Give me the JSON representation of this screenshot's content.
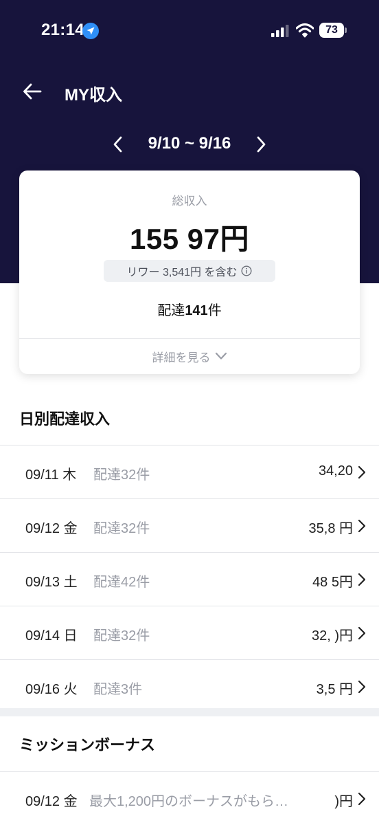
{
  "status_bar": {
    "time": "21:14",
    "battery": "73",
    "icons": [
      "location-arrow-icon",
      "signal-icon",
      "wifi-icon",
      "battery-icon"
    ]
  },
  "header": {
    "title": "MY収入",
    "date_range": "9/10 ~ 9/16",
    "background_color": "#17143c"
  },
  "summary_card": {
    "label": "総収入",
    "total": "155 97円",
    "reward_text": "リワー 3,541円 を含む",
    "delivery_count_prefix": "配達",
    "delivery_count": "141",
    "delivery_count_suffix": "件",
    "details_label": "詳細を見る"
  },
  "daily_section": {
    "title": "日別配達収入",
    "rows": [
      {
        "date": "09/11 木",
        "count": "配達32件",
        "amount": "34,20"
      },
      {
        "date": "09/12 金",
        "count": "配達32件",
        "amount": "35,8 円"
      },
      {
        "date": "09/13 土",
        "count": "配達42件",
        "amount": "48 5円"
      },
      {
        "date": "09/14 日",
        "count": "配達32件",
        "amount": "32, )円"
      },
      {
        "date": "09/16 火",
        "count": "配達3件",
        "amount": "3,5 円"
      }
    ]
  },
  "bonus_section": {
    "title": "ミッションボーナス",
    "rows": [
      {
        "date": "09/12 金",
        "text": "最大1,200円のボーナスがもら…",
        "amount": ")円"
      }
    ]
  }
}
